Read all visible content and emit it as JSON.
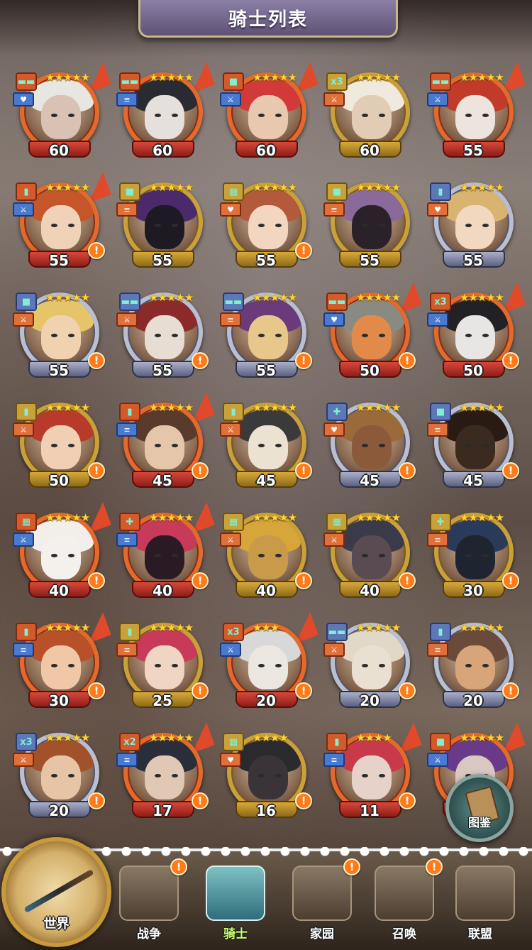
{
  "header": {
    "title": "骑士列表"
  },
  "knights": [
    {
      "level": "60",
      "stars": "★★★★★",
      "frame": "orange",
      "alert": false,
      "class_glyph": "▬▬",
      "role_glyph": "♥",
      "hair": "#e8e6e0",
      "skin": "#d9c2b4"
    },
    {
      "level": "60",
      "stars": "★★★★★",
      "frame": "orange",
      "alert": false,
      "class_glyph": "▬▬",
      "role_glyph": "≡",
      "hair": "#2a2a32",
      "skin": "#e6e0dc"
    },
    {
      "level": "60",
      "stars": "★★★★★",
      "frame": "orange",
      "alert": false,
      "class_glyph": "■",
      "role_glyph": "⚔",
      "hair": "#d23a3a",
      "skin": "#e9c8b0"
    },
    {
      "level": "60",
      "stars": "★★★★★",
      "frame": "gold",
      "alert": false,
      "class_glyph": "x3",
      "role_glyph": "⚔",
      "hair": "#efe9de",
      "skin": "#e3ccb6"
    },
    {
      "level": "55",
      "stars": "★★★★★",
      "frame": "orange",
      "alert": false,
      "class_glyph": "▬▬",
      "role_glyph": "⚔",
      "hair": "#c23a2a",
      "skin": "#ede4de"
    },
    {
      "level": "55",
      "stars": "★★★★★",
      "frame": "orange",
      "alert": true,
      "class_glyph": "▮",
      "role_glyph": "⚔",
      "hair": "#c4562a",
      "skin": "#f0d2b8"
    },
    {
      "level": "55",
      "stars": "★★★★★",
      "frame": "gold",
      "alert": false,
      "class_glyph": "■",
      "role_glyph": "≡",
      "hair": "#4a2a6a",
      "skin": "#1e1a24"
    },
    {
      "level": "55",
      "stars": "★★★★★",
      "frame": "gold",
      "alert": true,
      "class_glyph": "▦",
      "role_glyph": "♥",
      "hair": "#b25a3a",
      "skin": "#f2d6c0"
    },
    {
      "level": "55",
      "stars": "★★★★★",
      "frame": "gold",
      "alert": false,
      "class_glyph": "■",
      "role_glyph": "≡",
      "hair": "#8a6a9a",
      "skin": "#2a2228"
    },
    {
      "level": "55",
      "stars": "★★★★★",
      "frame": "silver",
      "alert": false,
      "class_glyph": "▮",
      "role_glyph": "♥",
      "hair": "#d8b470",
      "skin": "#f2d8c0"
    },
    {
      "level": "55",
      "stars": "★★★★★",
      "frame": "silver",
      "alert": true,
      "class_glyph": "■",
      "role_glyph": "⚔",
      "hair": "#e6c46a",
      "skin": "#f0d2b0"
    },
    {
      "level": "55",
      "stars": "★★★★★",
      "frame": "silver",
      "alert": true,
      "class_glyph": "▬▬",
      "role_glyph": "⚔",
      "hair": "#8a2a2a",
      "skin": "#e8ddd2"
    },
    {
      "level": "55",
      "stars": "★★★★★",
      "frame": "silver",
      "alert": true,
      "class_glyph": "▬▬",
      "role_glyph": "≡",
      "hair": "#6a3a7a",
      "skin": "#e8c88a"
    },
    {
      "level": "50",
      "stars": "★★★★★",
      "frame": "orange",
      "alert": true,
      "class_glyph": "▬▬",
      "role_glyph": "♥",
      "hair": "#8a8a82",
      "skin": "#e28a4a"
    },
    {
      "level": "50",
      "stars": "★★★★★",
      "frame": "orange",
      "alert": true,
      "class_glyph": "x3",
      "role_glyph": "⚔",
      "hair": "#222226",
      "skin": "#e8e6e4"
    },
    {
      "level": "50",
      "stars": "★★★★★",
      "frame": "gold",
      "alert": true,
      "class_glyph": "▮",
      "role_glyph": "⚔",
      "hair": "#b83a2a",
      "skin": "#f0cfb4"
    },
    {
      "level": "45",
      "stars": "★★★★★",
      "frame": "orange",
      "alert": true,
      "class_glyph": "▮",
      "role_glyph": "≡",
      "hair": "#5a3a2a",
      "skin": "#e6c6aa"
    },
    {
      "level": "45",
      "stars": "★★★★★",
      "frame": "gold",
      "alert": true,
      "class_glyph": "▮",
      "role_glyph": "⚔",
      "hair": "#3a3a3a",
      "skin": "#ebe2d2"
    },
    {
      "level": "45",
      "stars": "★★★★★",
      "frame": "silver",
      "alert": true,
      "class_glyph": "✚",
      "role_glyph": "♥",
      "hair": "#9a6a3a",
      "skin": "#8a5a3a"
    },
    {
      "level": "45",
      "stars": "★★★★★",
      "frame": "silver",
      "alert": true,
      "class_glyph": "■",
      "role_glyph": "≡",
      "hair": "#2a1a14",
      "skin": "#3a2a20"
    },
    {
      "level": "40",
      "stars": "★★★★★",
      "frame": "orange",
      "alert": true,
      "class_glyph": "▦",
      "role_glyph": "⚔",
      "hair": "#f2eeea",
      "skin": "#f4f0ec"
    },
    {
      "level": "40",
      "stars": "★★★★★",
      "frame": "orange",
      "alert": true,
      "class_glyph": "✚",
      "role_glyph": "≡",
      "hair": "#c83a5a",
      "skin": "#2a1a24"
    },
    {
      "level": "40",
      "stars": "★★★★★",
      "frame": "gold",
      "alert": true,
      "class_glyph": "▦",
      "role_glyph": "⚔",
      "hair": "#d6a63a",
      "skin": "#c89a4a"
    },
    {
      "level": "40",
      "stars": "★★★★★",
      "frame": "gold",
      "alert": true,
      "class_glyph": "▦",
      "role_glyph": "⚔",
      "hair": "#3a3a4a",
      "skin": "#5a4a52"
    },
    {
      "level": "30",
      "stars": "★★★★★",
      "frame": "gold",
      "alert": true,
      "class_glyph": "✚",
      "role_glyph": "≡",
      "hair": "#2a3a5a",
      "skin": "#1e2430"
    },
    {
      "level": "30",
      "stars": "★★★★★",
      "frame": "orange",
      "alert": true,
      "class_glyph": "▮",
      "role_glyph": "≡",
      "hair": "#b8502a",
      "skin": "#f0c8a8"
    },
    {
      "level": "25",
      "stars": "★★★★★",
      "frame": "gold",
      "alert": true,
      "class_glyph": "▮",
      "role_glyph": "≡",
      "hair": "#c83a5a",
      "skin": "#f0d4c4"
    },
    {
      "level": "20",
      "stars": "★★★",
      "frame": "orange",
      "alert": true,
      "class_glyph": "x3",
      "role_glyph": "⚔",
      "hair": "#d8d8d8",
      "skin": "#ece6e0"
    },
    {
      "level": "20",
      "stars": "★★★★★",
      "frame": "silver",
      "alert": true,
      "class_glyph": "▬▬",
      "role_glyph": "⚔",
      "hair": "#e2d8c8",
      "skin": "#eae0d2"
    },
    {
      "level": "20",
      "stars": "★★★★★",
      "frame": "silver",
      "alert": true,
      "class_glyph": "▮",
      "role_glyph": "≡",
      "hair": "#6a4a3a",
      "skin": "#d8a47a"
    },
    {
      "level": "20",
      "stars": "★★★★★",
      "frame": "silver",
      "alert": true,
      "class_glyph": "x3",
      "role_glyph": "⚔",
      "hair": "#a2522a",
      "skin": "#e8c4a6"
    },
    {
      "level": "17",
      "stars": "★★★★★",
      "frame": "orange",
      "alert": true,
      "class_glyph": "x2",
      "role_glyph": "≡",
      "hair": "#2a2e3a",
      "skin": "#e0c8b4"
    },
    {
      "level": "16",
      "stars": "★★★★",
      "frame": "gold",
      "alert": true,
      "class_glyph": "▦",
      "role_glyph": "♥",
      "hair": "#2a2a2e",
      "skin": "#3a3438"
    },
    {
      "level": "11",
      "stars": "★★★★",
      "frame": "orange",
      "alert": true,
      "class_glyph": "▮",
      "role_glyph": "≡",
      "hair": "#c83a4a",
      "skin": "#e6d2c8"
    },
    {
      "level": "",
      "stars": "★★★★★",
      "frame": "orange",
      "alert": false,
      "class_glyph": "■",
      "role_glyph": "⚔",
      "hair": "#6a3a8a",
      "skin": "#d8c8c0"
    }
  ],
  "codex": {
    "label": "图鉴"
  },
  "nav": {
    "world": "世界",
    "items": [
      {
        "label": "战争",
        "alert": true,
        "active": false
      },
      {
        "label": "骑士",
        "alert": false,
        "active": true
      },
      {
        "label": "家园",
        "alert": true,
        "active": false
      },
      {
        "label": "召唤",
        "alert": true,
        "active": false
      },
      {
        "label": "联盟",
        "alert": false,
        "active": false
      }
    ]
  },
  "alert_glyph": "!"
}
